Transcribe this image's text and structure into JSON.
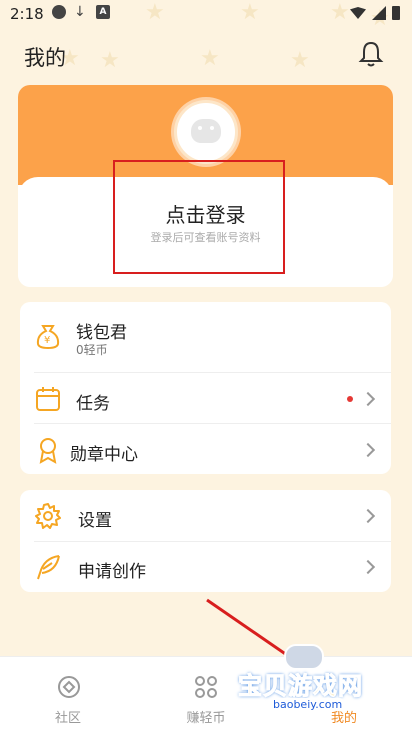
{
  "status_bar": {
    "time": "2:18",
    "a_badge": "A"
  },
  "header": {
    "title": "我的",
    "bell_icon": "bell-icon"
  },
  "profile": {
    "login_title": "点击登录",
    "login_subtitle": "登录后可查看账号资料",
    "accent_color": "#fca24a"
  },
  "menu_group_1": {
    "wallet": {
      "label": "钱包君",
      "sub": "0轻币",
      "icon": "money-bag-icon"
    },
    "tasks": {
      "label": "任务",
      "icon": "calendar-icon",
      "has_dot": true
    },
    "medals": {
      "label": "勋章中心",
      "icon": "medal-icon"
    }
  },
  "menu_group_2": {
    "settings": {
      "label": "设置",
      "icon": "gear-icon"
    },
    "apply": {
      "label": "申请创作",
      "icon": "feather-icon"
    }
  },
  "tabs": [
    {
      "label": "社区",
      "icon": "community-icon"
    },
    {
      "label": "赚轻币",
      "icon": "grid-icon"
    },
    {
      "label": "我的",
      "icon": "profile-icon",
      "active": true
    }
  ],
  "watermark": {
    "text": "宝贝游戏网",
    "url": "baobeiy.com"
  },
  "colors": {
    "highlight": "#d81e1e",
    "active_tab": "#f08a24"
  }
}
